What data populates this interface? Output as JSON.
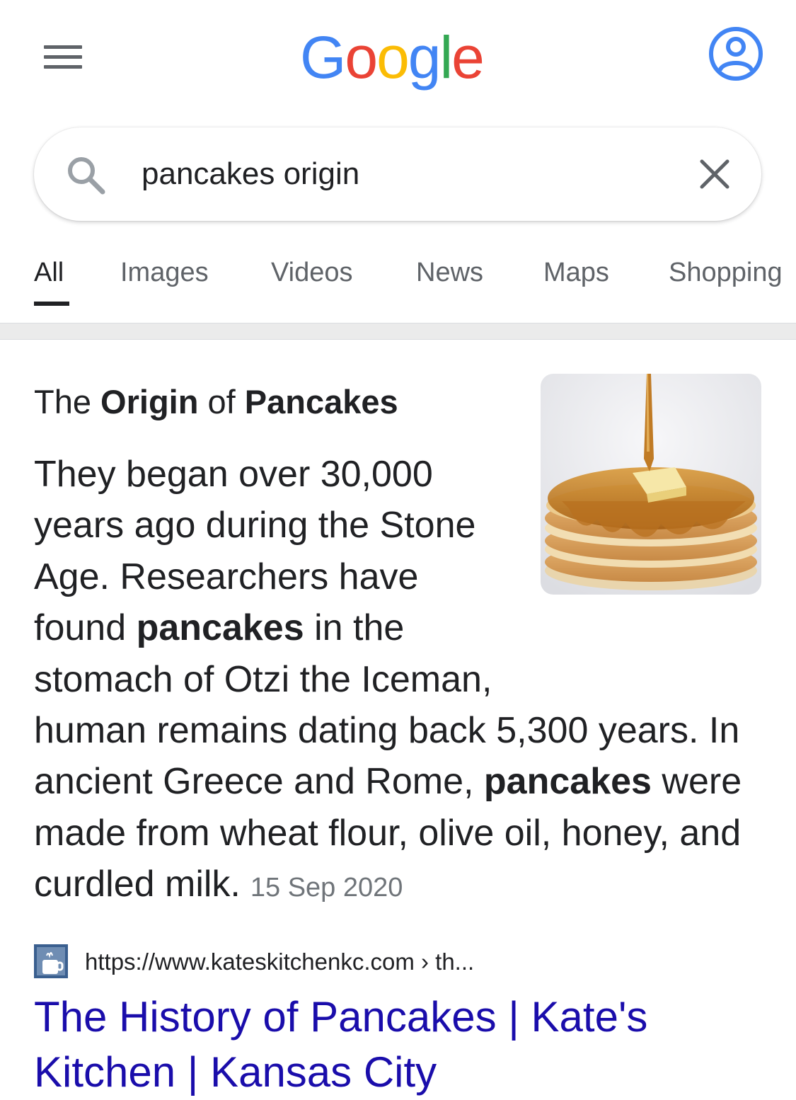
{
  "header": {
    "logo_text": "Google",
    "logo_colors": [
      "#4285F4",
      "#EA4335",
      "#FBBC05",
      "#4285F4",
      "#34A853",
      "#EA4335"
    ]
  },
  "search": {
    "query": "pancakes origin"
  },
  "tabs": [
    {
      "label": "All",
      "active": true
    },
    {
      "label": "Images",
      "active": false
    },
    {
      "label": "Videos",
      "active": false
    },
    {
      "label": "News",
      "active": false
    },
    {
      "label": "Maps",
      "active": false
    },
    {
      "label": "Shopping",
      "active": false
    }
  ],
  "snippet": {
    "title_parts": [
      "The ",
      "Origin",
      " of ",
      "Pancakes"
    ],
    "text_parts": [
      "They began over 30,000 years ago during the Stone Age. Researchers have found ",
      "pancakes",
      " in the stomach of Otzi the Iceman, human remains dating back 5,300 years. In ancient Greece and Rome, ",
      "pancakes",
      " were made from wheat flour, olive oil, honey, and curdled milk."
    ],
    "date": "15 Sep 2020"
  },
  "result": {
    "url": "https://www.kateskitchenkc.com › th...",
    "title": "The History of Pancakes | Kate's Kitchen | Kansas City"
  },
  "colors": {
    "link": "#1a0dab",
    "accent_blue": "#4285F4",
    "text_primary": "#202124",
    "text_secondary": "#5f6368"
  }
}
